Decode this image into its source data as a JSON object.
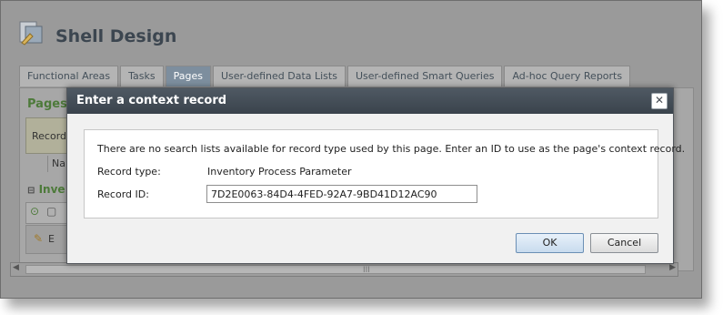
{
  "app": {
    "title": "Shell Design",
    "icon": "shell-design-icon"
  },
  "tabs": [
    {
      "label": "Functional Areas",
      "active": false
    },
    {
      "label": "Tasks",
      "active": false
    },
    {
      "label": "Pages",
      "active": true
    },
    {
      "label": "User-defined Data Lists",
      "active": false
    },
    {
      "label": "User-defined Smart Queries",
      "active": false
    },
    {
      "label": "Ad-hoc Query Reports",
      "active": false
    }
  ],
  "background": {
    "pages_label": "Pages",
    "record_label": "Record",
    "na_label": "Na",
    "inv_label": "Inve",
    "row_label": "E",
    "scroll_grip": "III"
  },
  "dialog": {
    "title": "Enter a context record",
    "close_icon": "close-icon",
    "message": "There are no search lists available for record type used by this page. Enter an ID to use as the page's context record.",
    "record_type_label": "Record type:",
    "record_type_value": "Inventory Process Parameter",
    "record_id_label": "Record ID:",
    "record_id_value": "7D2E0063-84D4-4FED-92A7-9BD41D12AC90",
    "ok_label": "OK",
    "cancel_label": "Cancel"
  },
  "colors": {
    "titlebar": "#3f4851",
    "ok_border": "#6b8fb5",
    "section_green": "#4d7a3a"
  }
}
